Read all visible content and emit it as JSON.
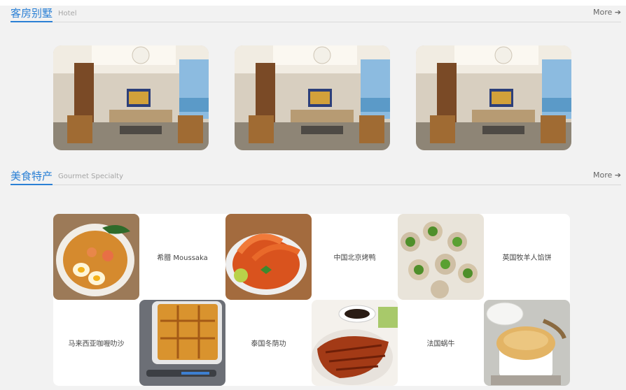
{
  "hotel_section": {
    "title": "客房别墅",
    "subtitle": "Hotel",
    "more_label": "More"
  },
  "food_section": {
    "title": "美食特产",
    "subtitle": "Gourmet Specialty",
    "more_label": "More",
    "items": [
      {
        "name": "希腊 Moussaka"
      },
      {
        "name": "中国北京烤鸭"
      },
      {
        "name": "英国牧羊人馅饼"
      },
      {
        "name": "马来西亚咖喱叻沙"
      },
      {
        "name": "泰国冬荫功"
      },
      {
        "name": "法国蜗牛"
      }
    ]
  },
  "icons": {
    "more_arrow": "arrow-right-icon"
  }
}
